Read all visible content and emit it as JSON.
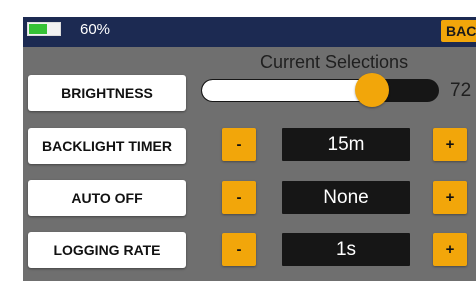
{
  "status_bar": {
    "battery_percent": 60,
    "battery_text": "60%",
    "back_label": "BAC"
  },
  "section_title": "Current Selections",
  "settings": {
    "brightness": {
      "label": "BRIGHTNESS",
      "value_text": "72",
      "slider_fraction": 0.72
    },
    "backlight_timer": {
      "label": "BACKLIGHT TIMER",
      "minus": "-",
      "value": "15m",
      "plus": "+"
    },
    "auto_off": {
      "label": "AUTO OFF",
      "minus": "-",
      "value": "None",
      "plus": "+"
    },
    "logging_rate": {
      "label": "LOGGING RATE",
      "minus": "-",
      "value": "1s",
      "plus": "+"
    }
  },
  "colors": {
    "accent": "#f2a60a",
    "status_bar": "#1c2a52",
    "panel": "#6f6f6f",
    "battery_fill": "#36c236"
  }
}
